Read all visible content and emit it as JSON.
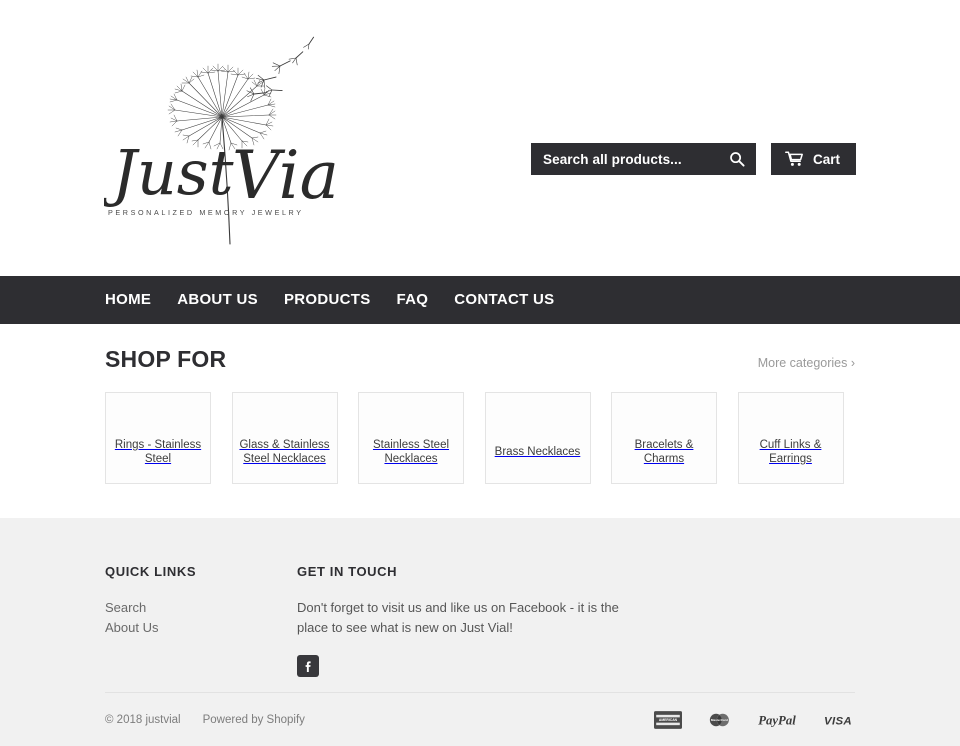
{
  "brand": {
    "logo_script": "Just Vial",
    "logo_tagline": "PERSONALIZED MEMORY JEWELRY",
    "logo_icon": "dandelion-icon"
  },
  "search": {
    "placeholder": "Search all products...",
    "value": "",
    "icon": "search-icon"
  },
  "cart": {
    "label": "Cart",
    "icon": "shopping-cart-icon"
  },
  "nav": {
    "items": [
      {
        "label": "HOME"
      },
      {
        "label": "ABOUT US"
      },
      {
        "label": "PRODUCTS"
      },
      {
        "label": "FAQ"
      },
      {
        "label": "CONTACT US"
      }
    ]
  },
  "shop": {
    "title": "SHOP FOR",
    "more_label": "More categories ›",
    "categories": [
      {
        "label": "Rings - Stainless Steel"
      },
      {
        "label": "Glass & Stainless Steel Necklaces"
      },
      {
        "label": "Stainless Steel Necklaces"
      },
      {
        "label": "Brass Necklaces"
      },
      {
        "label": "Bracelets & Charms"
      },
      {
        "label": "Cuff Links & Earrings"
      }
    ]
  },
  "footer": {
    "quick_links": {
      "heading": "QUICK LINKS",
      "items": [
        {
          "label": "Search"
        },
        {
          "label": "About Us"
        }
      ]
    },
    "get_in_touch": {
      "heading": "GET IN TOUCH",
      "text": "Don't forget to visit us and like us on Facebook - it is the place to see what is new on Just Vial!",
      "social": [
        {
          "name": "facebook-icon",
          "glyph": "f"
        }
      ]
    },
    "copyright": "© 2018 justvial",
    "powered_by": "Powered by Shopify",
    "payments": [
      {
        "name": "american-express-icon",
        "label": "AMERICAN EXPRESS"
      },
      {
        "name": "mastercard-icon",
        "label": "MasterCard"
      },
      {
        "name": "paypal-icon",
        "label": "PayPal"
      },
      {
        "name": "visa-icon",
        "label": "VISA"
      }
    ]
  },
  "colors": {
    "dark": "#2e2e32",
    "footer_bg": "#f1f1f1",
    "card_border": "#e4e4e4",
    "muted_text": "#9a9a9a"
  }
}
